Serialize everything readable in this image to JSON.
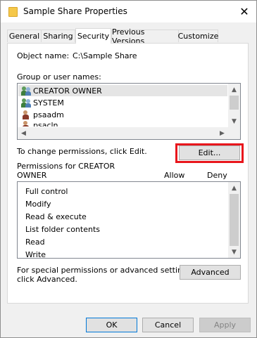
{
  "window": {
    "title": "Sample Share Properties",
    "close_glyph": "✕",
    "folder_color": "#f5c84a"
  },
  "tabs": [
    {
      "label": "General"
    },
    {
      "label": "Sharing"
    },
    {
      "label": "Security",
      "active": true
    },
    {
      "label": "Previous Versions"
    },
    {
      "label": "Customize"
    }
  ],
  "security": {
    "object_name_label": "Object name:",
    "object_name_value": "C:\\Sample Share",
    "groups_label": "Group or user names:",
    "groups": [
      {
        "name": "CREATOR OWNER",
        "icon": "group-icon",
        "selected": true
      },
      {
        "name": "SYSTEM",
        "icon": "group-icon"
      },
      {
        "name": "psaadm",
        "icon": "user-icon"
      },
      {
        "name": "psacln",
        "icon": "user-icon"
      }
    ],
    "change_text": "To change permissions, click Edit.",
    "edit_button": "Edit...",
    "permissions_label_line1": "Permissions for CREATOR",
    "permissions_label_line2": "OWNER",
    "allow_header": "Allow",
    "deny_header": "Deny",
    "permissions": [
      {
        "name": "Full control"
      },
      {
        "name": "Modify"
      },
      {
        "name": "Read & execute"
      },
      {
        "name": "List folder contents"
      },
      {
        "name": "Read"
      },
      {
        "name": "Write"
      }
    ],
    "special_text_line1": "For special permissions or advanced settings,",
    "special_text_line2": "click Advanced.",
    "advanced_button": "Advanced"
  },
  "footer": {
    "ok": "OK",
    "cancel": "Cancel",
    "apply": "Apply"
  },
  "accent_colors": {
    "highlight": "#e8161c",
    "focus": "#0078d7"
  }
}
